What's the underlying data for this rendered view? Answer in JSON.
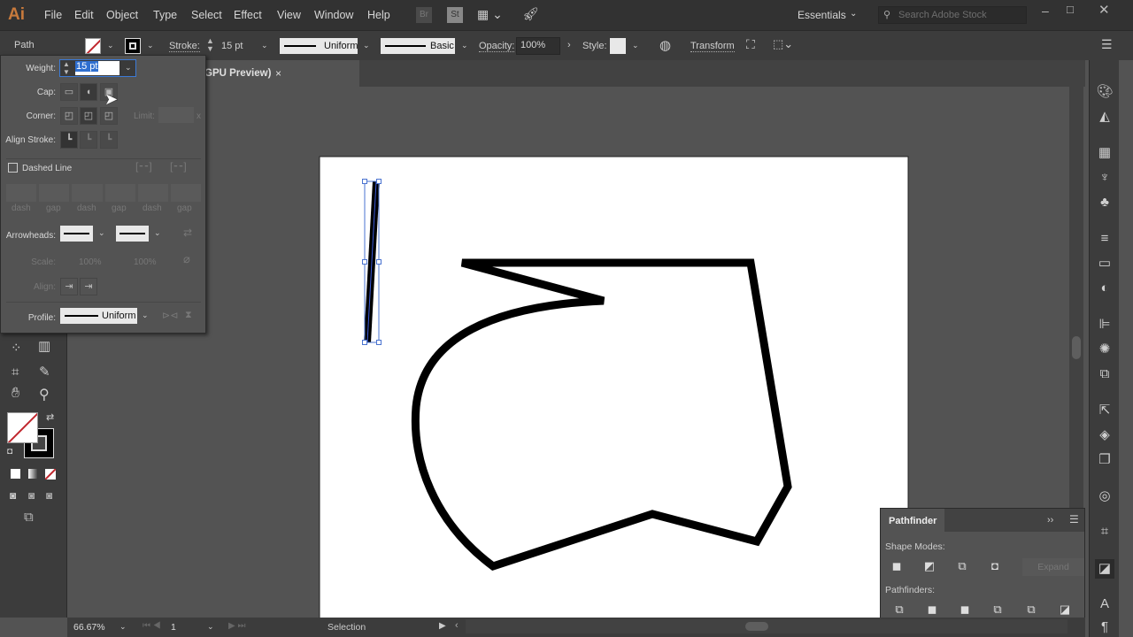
{
  "app": {
    "logo": "Ai",
    "menus": [
      "File",
      "Edit",
      "Object",
      "Type",
      "Select",
      "Effect",
      "View",
      "Window",
      "Help"
    ],
    "bridge": "Br",
    "stock": "St",
    "workspace": "Essentials",
    "search_placeholder": "Search Adobe Stock"
  },
  "control": {
    "selection_type": "Path",
    "stroke_label": "Stroke:",
    "stroke_weight": "15 pt",
    "variable_width": "Uniform",
    "brush": "Basic",
    "opacity_label": "Opacity:",
    "opacity": "100%",
    "style_label": "Style:",
    "transform": "Transform"
  },
  "document": {
    "tab_title": "GPU Preview)",
    "close": "×"
  },
  "stroke_panel": {
    "weight_label": "Weight:",
    "weight": "15 pt",
    "cap_label": "Cap:",
    "corner_label": "Corner:",
    "limit_label": "Limit:",
    "limit_x": "x",
    "align_label": "Align Stroke:",
    "dashed_label": "Dashed Line",
    "dash_labels": [
      "dash",
      "gap",
      "dash",
      "gap",
      "dash",
      "gap"
    ],
    "arrowheads_label": "Arrowheads:",
    "scale_label": "Scale:",
    "scale1": "100%",
    "scale2": "100%",
    "align2_label": "Align:",
    "profile_label": "Profile:",
    "profile": "Uniform"
  },
  "pathfinder": {
    "title": "Pathfinder",
    "shape_modes": "Shape Modes:",
    "expand": "Expand",
    "pathfinders": "Pathfinders:"
  },
  "status": {
    "zoom": "66.67%",
    "artboard": "1",
    "tool": "Selection"
  },
  "colors": {
    "accent": "#1473e6",
    "chrome": "#323232"
  }
}
